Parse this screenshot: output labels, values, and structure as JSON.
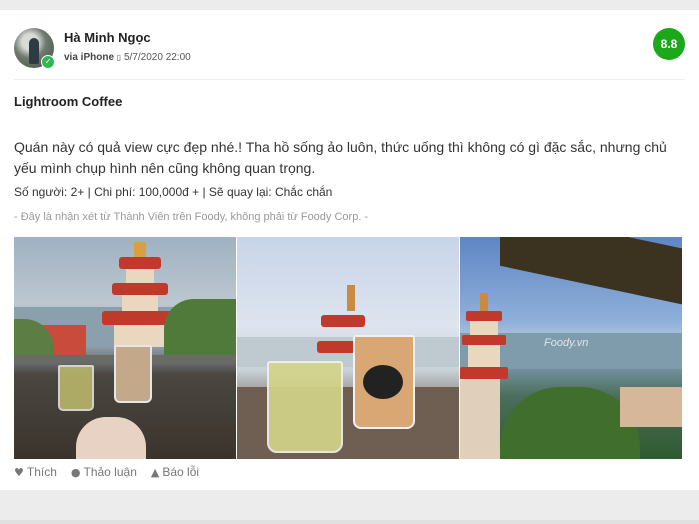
{
  "review": {
    "user_name": "Hà Minh Ngọc",
    "via_label": "via iPhone",
    "device_icon": "mobile-icon",
    "date": "5/7/2020 22:00",
    "score": "8.8",
    "score_color": "#1ba81b",
    "title": "Lightroom Coffee",
    "body": "Quán này có quả view cực đẹp nhé.! Tha hồ sống ảo luôn, thức uống thì không có gì đặc sắc, nhưng chủ yếu mình chụp hình nên cũng không quan trọng.",
    "stats": "Số người: 2+ | Chi phí: 100,000đ + | Sẽ quay lại: Chắc chắn",
    "disclaimer": "- Đây là nhận xét từ Thành Viên trên Foody, không phải từ Foody Corp. -",
    "photo_watermark": "Foody.vn"
  },
  "actions": {
    "like_label": "Thích",
    "like_icon": "heart-icon",
    "discuss_label": "Thảo luận",
    "discuss_icon": "comment-icon",
    "report_label": "Báo lỗi",
    "report_icon": "warning-icon"
  }
}
